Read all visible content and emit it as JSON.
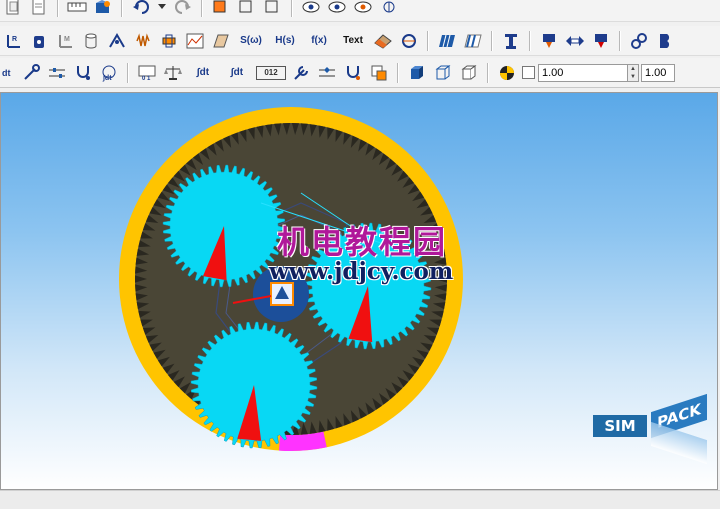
{
  "toolbar": {
    "row2": {
      "s_omega_label": "S(ω)",
      "h_s_label": "H(s)",
      "f_x_label": "f(x)",
      "text_label": "Text"
    },
    "row3": {
      "integrate_labels": [
        "∫dt",
        "∫dt",
        "∫dt"
      ],
      "display_label": "012",
      "field1_value": "1.00",
      "field2_value": "1.00"
    }
  },
  "viewport": {
    "watermark_title": "机电教程园",
    "watermark_url": "www.jdjcy.com",
    "logo": {
      "part1": "SIM",
      "part2": "PACK"
    }
  },
  "colors": {
    "ring": "#ffc400",
    "gear": "#08d8f4",
    "needle": "#f01010",
    "highlight": "#ff33ff",
    "logo": "#1f6aa5",
    "watermark": "#b0189a"
  }
}
